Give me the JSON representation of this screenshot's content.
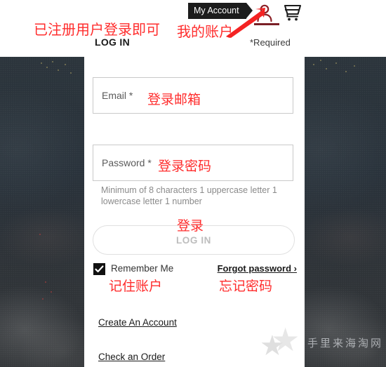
{
  "header": {
    "tooltip": "My Account",
    "account_icon": "person-icon",
    "cart_icon": "shopping-cart-icon"
  },
  "form": {
    "title": "LOG IN",
    "required_note": "*Required",
    "email_label": "Email *",
    "email_value": "",
    "password_label": "Password *",
    "password_value": "",
    "helper_text": "Minimum of 8 characters 1 uppercase letter 1 lowercase letter 1 number",
    "login_button": "LOG IN",
    "remember_label": "Remember Me",
    "remember_checked": true,
    "forgot_link": "Forgot password ›",
    "create_account_link": "Create An Account",
    "check_order_link": "Check an Order"
  },
  "annotations": {
    "top_left": "已注册用户登录即可",
    "my_account": "我的账户",
    "email": "登录邮箱",
    "password": "登录密码",
    "login": "登录",
    "remember": "记住账户",
    "forgot": "忘记密码",
    "color": "#ff2d2d"
  },
  "watermark": {
    "text": "手里来海淘网",
    "star_glyph": "★"
  },
  "colors": {
    "background_dark": "#2b3339",
    "card": "#ffffff",
    "tooltip_bg": "#1c1c1c",
    "account_accent": "#7a1f26",
    "annotation_red": "#ff2d2d"
  }
}
